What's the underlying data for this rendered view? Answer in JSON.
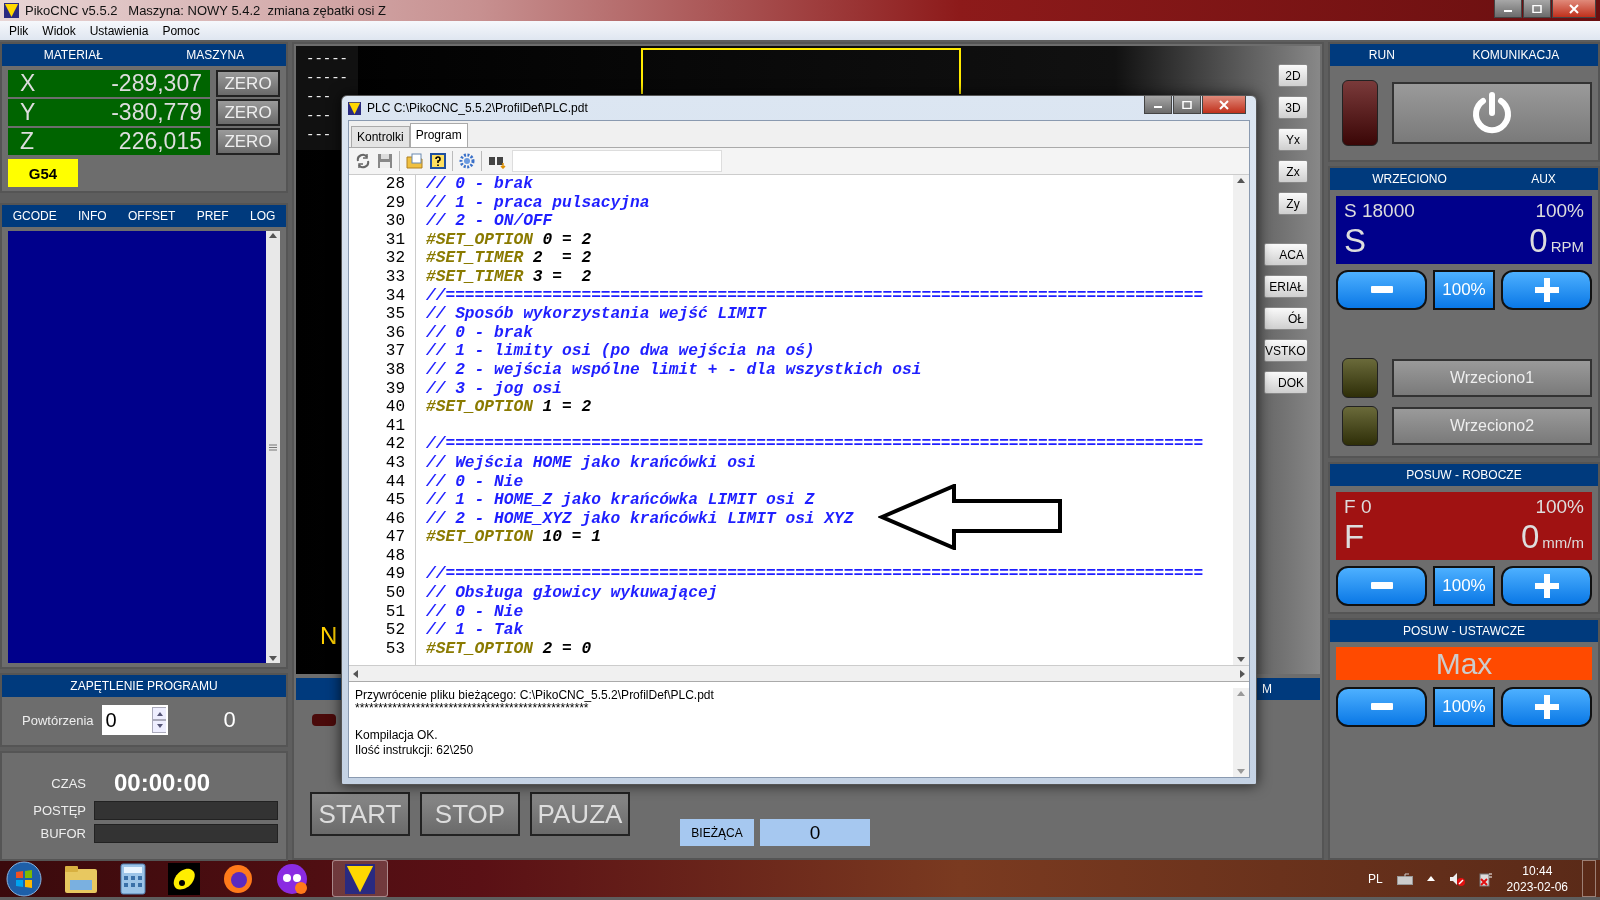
{
  "window": {
    "title": "PikoCNC v5.5.2   Maszyna: NOWY 5.4.2  zmiana zębatki osi Z"
  },
  "menu": [
    "Plik",
    "Widok",
    "Ustawienia",
    "Pomoc"
  ],
  "position_panel": {
    "headers": [
      "MATERIAŁ",
      "MASZYNA"
    ],
    "axes": [
      {
        "axis": "X",
        "value": "-289,307",
        "button": "ZERO"
      },
      {
        "axis": "Y",
        "value": "-380,779",
        "button": "ZERO"
      },
      {
        "axis": "Z",
        "value": "226,015",
        "button": "ZERO"
      }
    ],
    "work_offset": "G54"
  },
  "info_tabs": [
    "GCODE",
    "INFO",
    "OFFSET",
    "PREF",
    "LOG"
  ],
  "loop": {
    "title": "ZAPĘTLENIE PROGRAMU",
    "label": "Powtórzenia",
    "value": "0",
    "count": "0"
  },
  "timer": {
    "time_label": "CZAS",
    "time": "00:00:00",
    "progress_label": "POSTĘP",
    "progress": {
      "level": 0
    },
    "buffer_label": "BUFOR",
    "buffer": {
      "level": 0
    }
  },
  "viewport": {
    "dashes": [
      "-----",
      "-----",
      "---",
      "---",
      "---"
    ],
    "overlay_letter": "N",
    "view_buttons": [
      "2D",
      "3D",
      "Yx",
      "Zx",
      "Zy"
    ],
    "mode_buttons": [
      "ACA",
      "ERIAŁ",
      "ÓŁ",
      "VSTKO",
      "DOK"
    ]
  },
  "control_bar": {
    "tab_fragment": "M",
    "buttons": [
      "START",
      "STOP",
      "PAUZA"
    ],
    "line_label": "BIEŻĄCA",
    "line_value": "0"
  },
  "plc_window": {
    "title": "PLC C:\\PikoCNC_5.5.2\\ProfilDef\\PLC.pdt",
    "tabs": [
      {
        "label": "Kontrolki",
        "selected": false
      },
      {
        "label": "Program",
        "selected": true
      }
    ],
    "code": [
      {
        "line": "28",
        "kind": "comment",
        "text": "// 0 - brak"
      },
      {
        "line": "29",
        "kind": "comment",
        "text": "// 1 - praca pulsacyjna"
      },
      {
        "line": "30",
        "kind": "comment",
        "text": "// 2 - ON/OFF"
      },
      {
        "line": "31",
        "kind": "directive",
        "text": "#SET_OPTION 0 = 2"
      },
      {
        "line": "32",
        "kind": "directive",
        "text": "#SET_TIMER 2  = 2"
      },
      {
        "line": "33",
        "kind": "directive",
        "text": "#SET_TIMER 3 =  2"
      },
      {
        "line": "34",
        "kind": "comment",
        "text": "//=============================================================================="
      },
      {
        "line": "35",
        "kind": "comment",
        "text": "// Sposób wykorzystania wejść LIMIT"
      },
      {
        "line": "36",
        "kind": "comment",
        "text": "// 0 - brak"
      },
      {
        "line": "37",
        "kind": "comment",
        "text": "// 1 - limity osi (po dwa wejścia na oś)"
      },
      {
        "line": "38",
        "kind": "comment",
        "text": "// 2 - wejścia wspólne limit + - dla wszystkich osi"
      },
      {
        "line": "39",
        "kind": "comment",
        "text": "// 3 - jog osi"
      },
      {
        "line": "40",
        "kind": "directive",
        "text": "#SET_OPTION 1 = 2"
      },
      {
        "line": "41",
        "kind": "blank"
      },
      {
        "line": "42",
        "kind": "comment",
        "text": "//=============================================================================="
      },
      {
        "line": "43",
        "kind": "comment",
        "text": "// Wejścia HOME jako krańcówki osi"
      },
      {
        "line": "44",
        "kind": "comment",
        "text": "// 0 - Nie"
      },
      {
        "line": "45",
        "kind": "comment",
        "text": "// 1 - HOME_Z jako krańcówka LIMIT osi Z"
      },
      {
        "line": "46",
        "kind": "comment",
        "text": "// 2 - HOME_XYZ jako krańcówki LIMIT osi XYZ"
      },
      {
        "line": "47",
        "kind": "directive",
        "text": "#SET_OPTION 10 = 1"
      },
      {
        "line": "48",
        "kind": "blank"
      },
      {
        "line": "49",
        "kind": "comment",
        "text": "//=============================================================================="
      },
      {
        "line": "50",
        "kind": "comment",
        "text": "// Obsługa głowicy wykuwającej"
      },
      {
        "line": "51",
        "kind": "comment",
        "text": "// 0 - Nie"
      },
      {
        "line": "52",
        "kind": "comment",
        "text": "// 1 - Tak"
      },
      {
        "line": "53",
        "kind": "directive",
        "text": "#SET_OPTION 2 = 0"
      }
    ],
    "output": [
      {
        "kind": "text",
        "text": "Przywrócenie pliku bieżącego: C:\\PikoCNC_5.5.2\\ProfilDef\\PLC.pdt"
      },
      {
        "kind": "rule",
        "text": "**************************************************"
      },
      {
        "kind": "text",
        "text": "Kompilacja OK."
      },
      {
        "kind": "text",
        "text": "Ilość instrukcji: 62\\250"
      }
    ]
  },
  "right_panel": {
    "run_headers": [
      "RUN",
      "KOMUNIKACJA"
    ],
    "run_led": {
      "on": false
    },
    "spindle_headers": [
      "WRZECIONO",
      "AUX"
    ],
    "spindle": {
      "setpoint": "S 18000",
      "override": "100%",
      "symbol": "S",
      "value": "0",
      "unit": "RPM",
      "reset": "100%"
    },
    "outputs": [
      {
        "label": "Wrzeciono1",
        "on": false
      },
      {
        "label": "Wrzeciono2",
        "on": false
      }
    ],
    "feed": {
      "title": "POSUW - ROBOCZE",
      "setpoint": "F 0",
      "override": "100%",
      "symbol": "F",
      "value": "0",
      "unit": "mm/m",
      "reset": "100%"
    },
    "rapid": {
      "title": "POSUW - USTAWCZE",
      "value": "Max",
      "reset": "100%"
    }
  },
  "taskbar": {
    "language": "PL",
    "time": "10:44",
    "date": "2023-02-06"
  }
}
